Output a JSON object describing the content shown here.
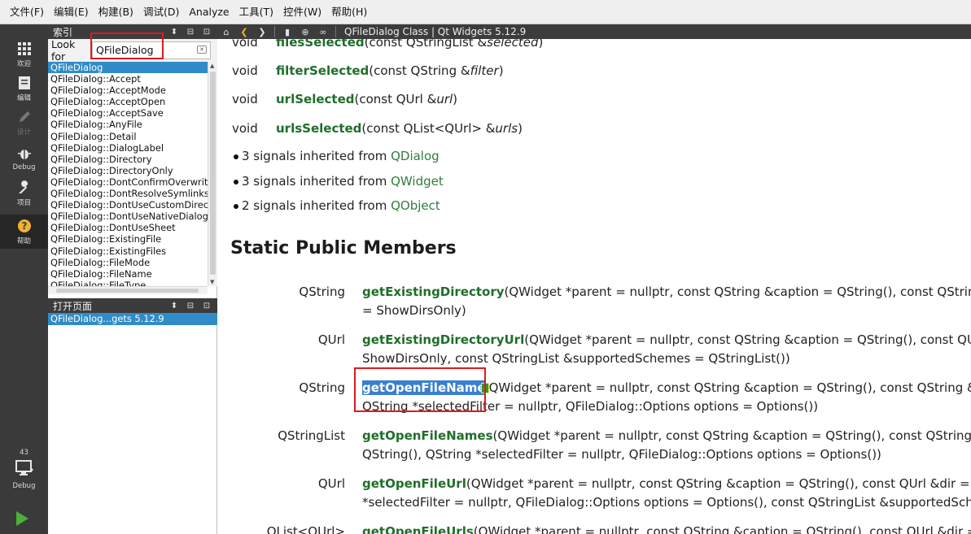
{
  "menu": [
    "文件(F)",
    "编辑(E)",
    "构建(B)",
    "调试(D)",
    "Analyze",
    "工具(T)",
    "控件(W)",
    "帮助(H)"
  ],
  "modes": [
    {
      "label": "欢迎",
      "icon": "grid-icon"
    },
    {
      "label": "编辑",
      "icon": "document-icon"
    },
    {
      "label": "设计",
      "icon": "pencil-icon"
    },
    {
      "label": "Debug",
      "icon": "bug-icon"
    },
    {
      "label": "项目",
      "icon": "wrench-icon"
    },
    {
      "label": "帮助",
      "icon": "help-icon"
    }
  ],
  "kit": {
    "number": "43",
    "label": "Debug"
  },
  "index_pane": {
    "title": "索引"
  },
  "look_for": {
    "label": "Look for",
    "value": "QFileDialog"
  },
  "index_items": [
    "QFileDialog",
    "QFileDialog::Accept",
    "QFileDialog::AcceptMode",
    "QFileDialog::AcceptOpen",
    "QFileDialog::AcceptSave",
    "QFileDialog::AnyFile",
    "QFileDialog::Detail",
    "QFileDialog::DialogLabel",
    "QFileDialog::Directory",
    "QFileDialog::DirectoryOnly",
    "QFileDialog::DontConfirmOverwrit",
    "QFileDialog::DontResolveSymlinks",
    "QFileDialog::DontUseCustomDirec",
    "QFileDialog::DontUseNativeDialog",
    "QFileDialog::DontUseSheet",
    "QFileDialog::ExistingFile",
    "QFileDialog::ExistingFiles",
    "QFileDialog::FileMode",
    "QFileDialog::FileName",
    "QFileDialog::FileType"
  ],
  "open_pane": {
    "title": "打开页面",
    "items": [
      "QFileDialog...gets 5.12.9"
    ]
  },
  "doc_title": "QFileDialog Class | Qt Widgets 5.12.9",
  "signals": [
    {
      "type": "void",
      "name": "filesSelected",
      "params": "(const QStringList &",
      "arg": "selected",
      "tail": ")"
    },
    {
      "type": "void",
      "name": "filterSelected",
      "params": "(const QString &",
      "arg": "filter",
      "tail": ")"
    },
    {
      "type": "void",
      "name": "urlSelected",
      "params": "(const QUrl &",
      "arg": "url",
      "tail": ")"
    },
    {
      "type": "void",
      "name": "urlsSelected",
      "params": "(const QList<QUrl> &",
      "arg": "urls",
      "tail": ")"
    }
  ],
  "inherited": [
    {
      "text": "3 signals inherited from ",
      "link": "QDialog"
    },
    {
      "text": "3 signals inherited from ",
      "link": "QWidget"
    },
    {
      "text": "2 signals inherited from ",
      "link": "QObject"
    }
  ],
  "section_title": "Static Public Members",
  "members": [
    {
      "type": "QString",
      "name": "getExistingDirectory",
      "line1": "(QWidget *parent = nullptr, const QString &caption = QString(), const QString &dir",
      "line2": "= ShowDirsOnly)"
    },
    {
      "type": "QUrl",
      "name": "getExistingDirectoryUrl",
      "line1": "(QWidget *parent = nullptr, const QString &caption = QString(), const QUrl &dir",
      "line2": "ShowDirsOnly, const QStringList &supportedSchemes = QStringList())"
    },
    {
      "type": "QString",
      "name": "getOpenFileName",
      "line1": "QWidget *parent = nullptr, const QString &caption = QString(), const QString &dir = Q",
      "line2": "QString *selectedFilter = nullptr, QFileDialog::Options options = Options())"
    },
    {
      "type": "QStringList",
      "name": "getOpenFileNames",
      "line1": "(QWidget *parent = nullptr, const QString &caption = QString(), const QString &dir =",
      "line2": "QString(), QString *selectedFilter = nullptr, QFileDialog::Options options = Options())"
    },
    {
      "type": "QUrl",
      "name": "getOpenFileUrl",
      "line1": "(QWidget *parent = nullptr, const QString &caption = QString(), const QUrl &dir = QUrl(),",
      "line2": "*selectedFilter = nullptr, QFileDialog::Options options = Options(), const QStringList &supportedSchem"
    },
    {
      "type": "QList<QUrl>",
      "name": "getOpenFileUrls",
      "line1": "(QWidget *parent = nullptr, const QString &caption = QString(), const QUrl &dir = QUrl(),",
      "line2": ""
    }
  ]
}
